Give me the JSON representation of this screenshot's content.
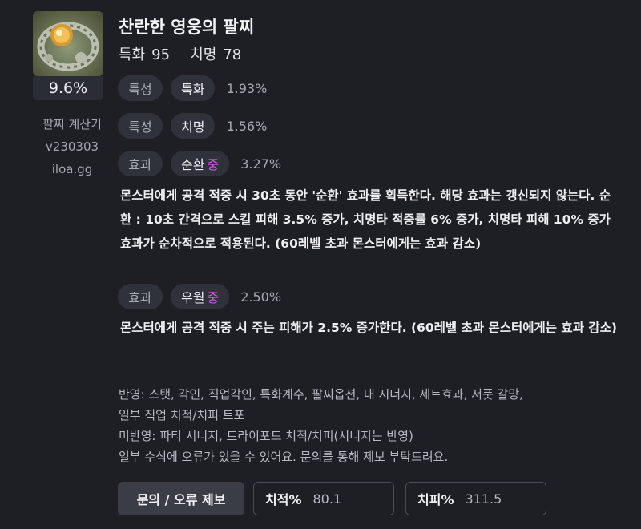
{
  "item": {
    "name": "찬란한 영웅의 팔찌",
    "icon": "bracelet-item-icon",
    "stats": [
      {
        "label": "특화",
        "value": "95"
      },
      {
        "label": "치명",
        "value": "78"
      }
    ],
    "percent": "9.6%"
  },
  "calculator": {
    "name": "팔찌 계산기",
    "version": "v230303",
    "site": "iloa.gg"
  },
  "effects": [
    {
      "category": "특성",
      "name": "특화",
      "grade": "",
      "value": "1.93%"
    },
    {
      "category": "특성",
      "name": "치명",
      "grade": "",
      "value": "1.56%"
    },
    {
      "category": "효과",
      "name": "순환",
      "grade": "중",
      "value": "3.27%",
      "description": "몬스터에게 공격 적중 시 30초 동안 '순환' 효과를 획득한다. 해당 효과는 갱신되지 않는다. 순환 : 10초 간격으로 스킬 피해 3.5% 증가, 치명타 적중률 6% 증가, 치명타 피해 10% 증가 효과가 순차적으로 적용된다. (60레벨 초과 몬스터에게는 효과 감소)"
    },
    {
      "category": "효과",
      "name": "우월",
      "grade": "중",
      "value": "2.50%",
      "description": "몬스터에게 공격 적중 시 주는 피해가 2.5% 증가한다. (60레벨 초과 몬스터에게는 효과 감소)"
    }
  ],
  "notes": {
    "reflected": "반영: 스탯, 각인, 직업각인, 특화계수, 팔찌옵션, 내 시너지, 세트효과, 서풋 갈망,",
    "reflected_cont": "일부 직업 치적/치피 트포",
    "not_reflected": "미반영: 파티 시너지, 트라이포드 치적/치피(시너지는 반영)",
    "disclaimer": "일부 수식에 오류가 있을 수 있어요. 문의를 통해 제보 부탁드려요."
  },
  "footer": {
    "report_button": "문의 / 오류 제보",
    "crit_rate_label": "치적%",
    "crit_rate_value": "80.1",
    "crit_dmg_label": "치피%",
    "crit_dmg_value": "311.5"
  },
  "colors": {
    "background": "#1e1f25",
    "pill": "#30323b",
    "grade_accent": "#d55ee8"
  }
}
